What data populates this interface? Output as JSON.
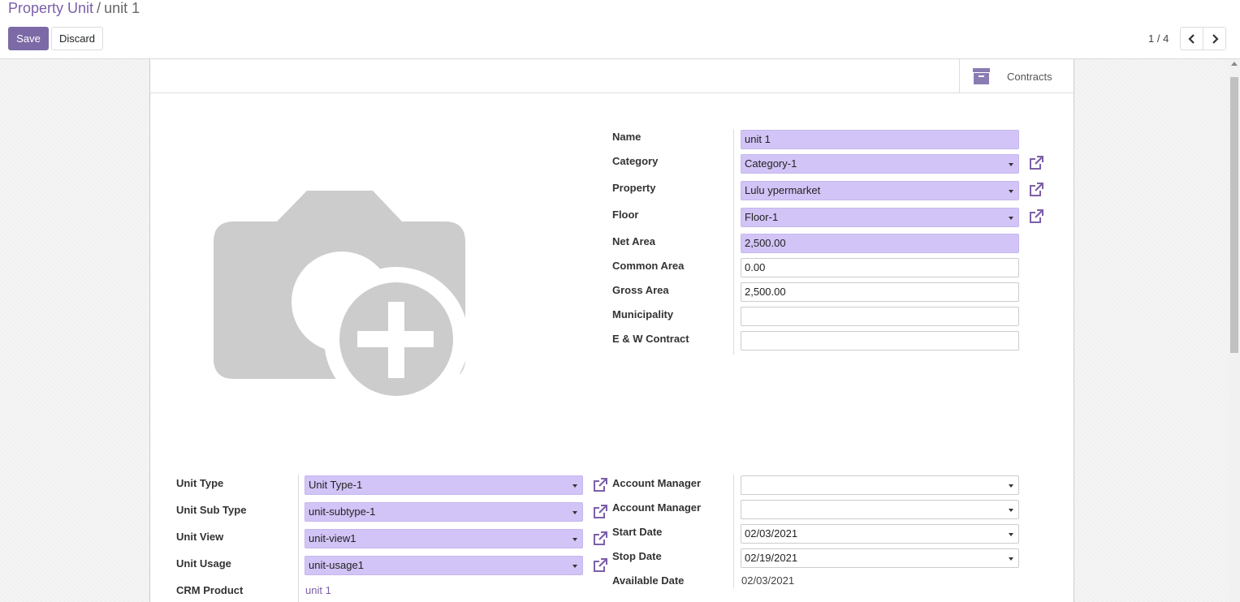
{
  "breadcrumb": {
    "parent": "Property Unit",
    "separator": "/",
    "current": "unit 1"
  },
  "toolbar": {
    "save_label": "Save",
    "discard_label": "Discard"
  },
  "pager": {
    "value": "1 / 4"
  },
  "smart_button": {
    "label": "Contracts",
    "icon": "archive-icon"
  },
  "avatar": {
    "icon": "camera-plus-icon"
  },
  "main_fields": {
    "name": {
      "label": "Name",
      "value": "unit 1"
    },
    "category": {
      "label": "Category",
      "value": "Category-1"
    },
    "property": {
      "label": "Property",
      "value": "Lulu ypermarket"
    },
    "floor": {
      "label": "Floor",
      "value": "Floor-1"
    },
    "net_area": {
      "label": "Net Area",
      "value": "2,500.00"
    },
    "common_area": {
      "label": "Common Area",
      "value": "0.00"
    },
    "gross_area": {
      "label": "Gross Area",
      "value": "2,500.00"
    },
    "municipality": {
      "label": "Municipality",
      "value": ""
    },
    "ew_contract": {
      "label": "E & W Contract",
      "value": ""
    }
  },
  "left_fields": {
    "unit_type": {
      "label": "Unit Type",
      "value": "Unit Type-1"
    },
    "unit_sub_type": {
      "label": "Unit Sub Type",
      "value": "unit-subtype-1"
    },
    "unit_view": {
      "label": "Unit View",
      "value": "unit-view1"
    },
    "unit_usage": {
      "label": "Unit Usage",
      "value": "unit-usage1"
    },
    "crm_product": {
      "label": "CRM Product",
      "value": "unit 1"
    }
  },
  "right_fields": {
    "account_manager_1": {
      "label": "Account Manager",
      "value": ""
    },
    "account_manager_2": {
      "label": "Account Manager",
      "value": ""
    },
    "start_date": {
      "label": "Start Date",
      "value": "02/03/2021"
    },
    "stop_date": {
      "label": "Stop Date",
      "value": "02/19/2021"
    },
    "available_date": {
      "label": "Available Date",
      "value": "02/03/2021"
    }
  },
  "colors": {
    "accent": "#7c6aa6",
    "required_bg": "#d2c4f6",
    "link": "#7c5fa8"
  }
}
